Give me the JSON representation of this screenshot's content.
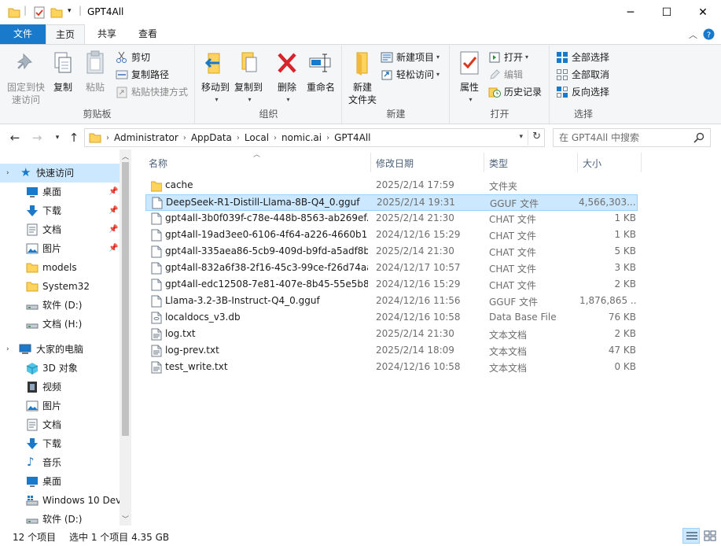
{
  "window": {
    "title": "GPT4All",
    "minimize": "─",
    "maximize": "☐",
    "close": "✕"
  },
  "ribbon_tabs": {
    "file": "文件",
    "home": "主页",
    "share": "共享",
    "view": "查看"
  },
  "ribbon": {
    "clipboard": {
      "label": "剪贴板",
      "pin_quick_access": "固定到快速访问",
      "pin_line1": "固定到快",
      "pin_line2": "速访问",
      "copy": "复制",
      "paste": "粘贴",
      "cut": "剪切",
      "copy_path": "复制路径",
      "paste_shortcut": "粘贴快捷方式"
    },
    "organize": {
      "label": "组织",
      "move_to": "移动到",
      "copy_to": "复制到",
      "delete": "删除",
      "rename": "重命名"
    },
    "new": {
      "label": "新建",
      "new_folder_line1": "新建",
      "new_folder_line2": "文件夹",
      "new_item": "新建项目",
      "easy_access": "轻松访问"
    },
    "open": {
      "label": "打开",
      "properties": "属性",
      "open": "打开",
      "edit": "编辑",
      "history": "历史记录"
    },
    "select": {
      "label": "选择",
      "select_all": "全部选择",
      "select_none": "全部取消",
      "invert": "反向选择"
    }
  },
  "address": {
    "crumbs": [
      "Administrator",
      "AppData",
      "Local",
      "nomic.ai",
      "GPT4All"
    ],
    "search_placeholder": "在 GPT4All 中搜索"
  },
  "nav_pane": {
    "quick_access": "快速访问",
    "desktop": "桌面",
    "downloads": "下载",
    "documents": "文档",
    "pictures": "图片",
    "models": "models",
    "system32": "System32",
    "software_d": "软件 (D:)",
    "docs_h": "文档 (H:)",
    "this_pc": "大家的电脑",
    "objects3d": "3D 对象",
    "videos": "视频",
    "pc_pictures": "图片",
    "pc_documents": "文档",
    "pc_downloads": "下载",
    "music": "音乐",
    "pc_desktop": "桌面",
    "win10": "Windows 10 Dev",
    "pc_software_d": "软件 (D:)"
  },
  "columns": {
    "name": "名称",
    "date": "修改日期",
    "type": "类型",
    "size": "大小"
  },
  "files": [
    {
      "name": "cache",
      "date": "2025/2/14 17:59",
      "type": "文件夹",
      "size": "",
      "icon": "folder-icon"
    },
    {
      "name": "DeepSeek-R1-Distill-Llama-8B-Q4_0.gguf",
      "date": "2025/2/14 19:31",
      "type": "GGUF 文件",
      "size": "4,566,303...",
      "icon": "file-icon"
    },
    {
      "name": "gpt4all-3b0f039f-c78e-448b-8563-ab269ef...",
      "date": "2025/2/14 21:30",
      "type": "CHAT 文件",
      "size": "1 KB",
      "icon": "file-icon"
    },
    {
      "name": "gpt4all-19ad3ee0-6106-4f64-a226-4660b18...",
      "date": "2024/12/16 15:29",
      "type": "CHAT 文件",
      "size": "1 KB",
      "icon": "file-icon"
    },
    {
      "name": "gpt4all-335aea86-5cb9-409d-b9fd-a5adf8b...",
      "date": "2025/2/14 21:30",
      "type": "CHAT 文件",
      "size": "5 KB",
      "icon": "file-icon"
    },
    {
      "name": "gpt4all-832a6f38-2f16-45c3-99ce-f26d74aa...",
      "date": "2024/12/17 10:57",
      "type": "CHAT 文件",
      "size": "3 KB",
      "icon": "file-icon"
    },
    {
      "name": "gpt4all-edc12508-7e81-407e-8b45-55e5b8...",
      "date": "2024/12/16 15:29",
      "type": "CHAT 文件",
      "size": "2 KB",
      "icon": "file-icon"
    },
    {
      "name": "Llama-3.2-3B-Instruct-Q4_0.gguf",
      "date": "2024/12/16 11:56",
      "type": "GGUF 文件",
      "size": "1,876,865 ...",
      "icon": "file-icon"
    },
    {
      "name": "localdocs_v3.db",
      "date": "2024/12/16 10:58",
      "type": "Data Base File",
      "size": "76 KB",
      "icon": "database-file-icon"
    },
    {
      "name": "log.txt",
      "date": "2025/2/14 21:30",
      "type": "文本文档",
      "size": "2 KB",
      "icon": "text-file-icon"
    },
    {
      "name": "log-prev.txt",
      "date": "2025/2/14 18:09",
      "type": "文本文档",
      "size": "47 KB",
      "icon": "text-file-icon"
    },
    {
      "name": "test_write.txt",
      "date": "2024/12/16 10:58",
      "type": "文本文档",
      "size": "0 KB",
      "icon": "text-file-icon"
    }
  ],
  "selected_index": 1,
  "status": {
    "item_count": "12 个项目",
    "selected": "选中 1 个项目  4.35 GB"
  },
  "colors": {
    "accent": "#1979ca",
    "selection": "#cce8ff",
    "selection_border": "#99d1ff",
    "folder": "#ffd35e"
  }
}
